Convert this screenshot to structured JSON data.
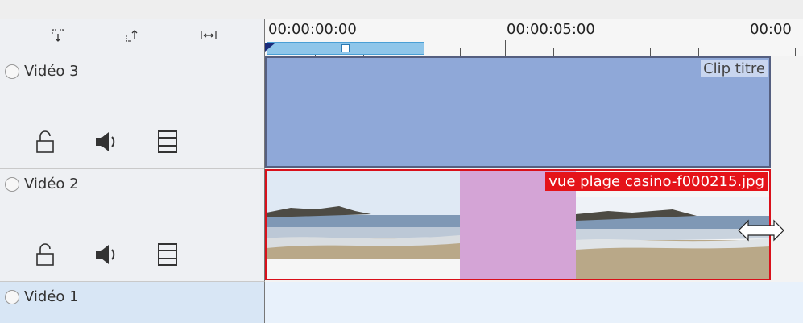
{
  "ruler": {
    "timecodes": [
      "00:00:00:00",
      "00:00:05:00",
      "00:00"
    ]
  },
  "header": {
    "buttons": [
      {
        "icon": "insert-track-icon"
      },
      {
        "icon": "extract-zone-icon"
      },
      {
        "icon": "fit-zoom-icon"
      }
    ]
  },
  "tracks": [
    {
      "name": "Vidéo 3",
      "icons": [
        "lock-icon",
        "speaker-icon",
        "film-icon"
      ]
    },
    {
      "name": "Vidéo 2",
      "icons": [
        "lock-icon",
        "speaker-icon",
        "film-icon"
      ]
    },
    {
      "name": "Vidéo 1"
    }
  ],
  "clips": {
    "title_clip": "Clip titre",
    "image_clip": "vue plage casino-f000215.jpg"
  },
  "colors": {
    "title_clip": "#8fa8d8",
    "image_clip_border": "#d9101a",
    "transition": "#d4a4d6",
    "zone": "#8fc6ea"
  }
}
